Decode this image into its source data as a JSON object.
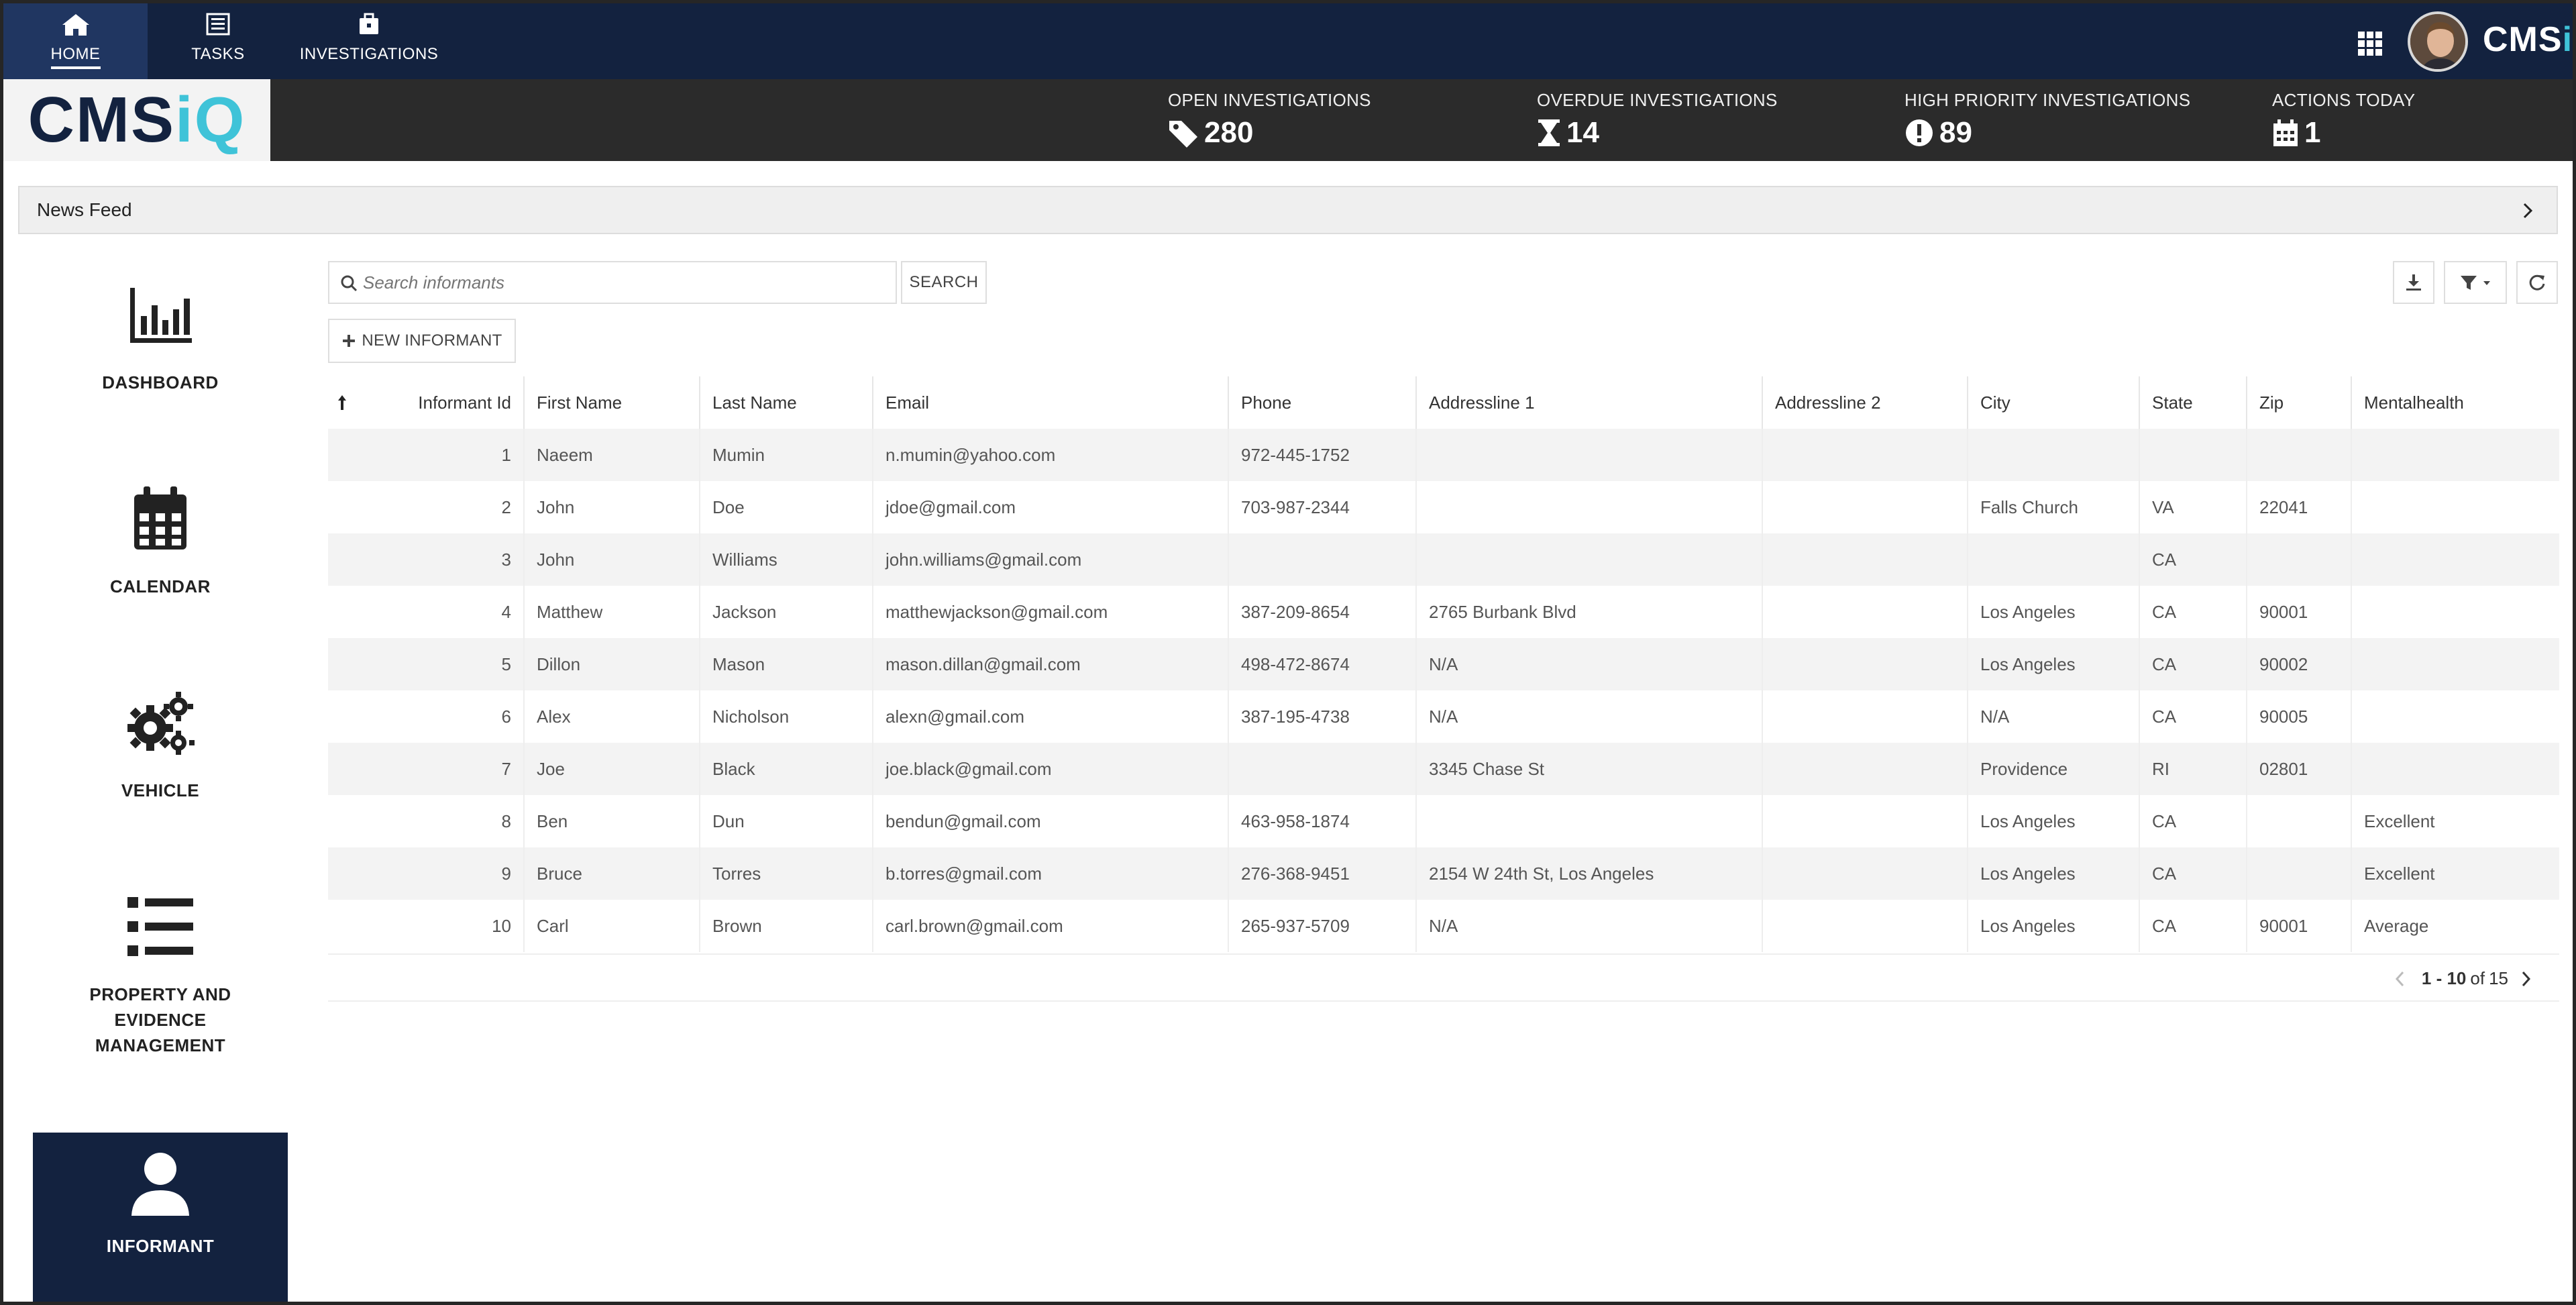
{
  "topnav": {
    "items": [
      {
        "label": "HOME",
        "icon": "home-icon"
      },
      {
        "label": "TASKS",
        "icon": "tasks-icon"
      },
      {
        "label": "INVESTIGATIONS",
        "icon": "briefcase-icon"
      }
    ],
    "brand": {
      "prefix": "CMS",
      "suffix": "iQ"
    }
  },
  "logo": {
    "prefix": "CMS",
    "suffix": "iQ"
  },
  "stats": [
    {
      "label": "OPEN INVESTIGATIONS",
      "value": "280",
      "icon": "tag-icon"
    },
    {
      "label": "OVERDUE INVESTIGATIONS",
      "value": "14",
      "icon": "hourglass-icon"
    },
    {
      "label": "HIGH PRIORITY INVESTIGATIONS",
      "value": "89",
      "icon": "exclamation-circle-icon"
    },
    {
      "label": "ACTIONS TODAY",
      "value": "1",
      "icon": "calendar-icon"
    }
  ],
  "newsfeed": {
    "label": "News Feed"
  },
  "sidebar": {
    "items": [
      {
        "label": "DASHBOARD",
        "icon": "bar-chart-icon"
      },
      {
        "label": "CALENDAR",
        "icon": "calendar-icon"
      },
      {
        "label": "VEHICLE",
        "icon": "gears-icon"
      },
      {
        "label": "PROPERTY AND EVIDENCE MANAGEMENT",
        "icon": "list-icon"
      },
      {
        "label": "INFORMANT",
        "icon": "user-icon",
        "active": true
      }
    ]
  },
  "search": {
    "placeholder": "Search informants",
    "button_label": "SEARCH"
  },
  "new_button": {
    "label": "NEW INFORMANT"
  },
  "table": {
    "columns": [
      "Informant Id",
      "First Name",
      "Last Name",
      "Email",
      "Phone",
      "Addressline 1",
      "Addressline 2",
      "City",
      "State",
      "Zip",
      "Mentalhealth"
    ],
    "rows": [
      [
        "1",
        "Naeem",
        "Mumin",
        "n.mumin@yahoo.com",
        "972-445-1752",
        "",
        "",
        "",
        "",
        "",
        ""
      ],
      [
        "2",
        "John",
        "Doe",
        "jdoe@gmail.com",
        "703-987-2344",
        "",
        "",
        "Falls Church",
        "VA",
        "22041",
        ""
      ],
      [
        "3",
        "John",
        "Williams",
        "john.williams@gmail.com",
        "",
        "",
        "",
        "",
        "CA",
        "",
        ""
      ],
      [
        "4",
        "Matthew",
        "Jackson",
        "matthewjackson@gmail.com",
        "387-209-8654",
        "2765 Burbank Blvd",
        "",
        "Los Angeles",
        "CA",
        "90001",
        ""
      ],
      [
        "5",
        "Dillon",
        "Mason",
        "mason.dillan@gmail.com",
        "498-472-8674",
        "N/A",
        "",
        "Los Angeles",
        "CA",
        "90002",
        ""
      ],
      [
        "6",
        "Alex",
        "Nicholson",
        "alexn@gmail.com",
        "387-195-4738",
        "N/A",
        "",
        "N/A",
        "CA",
        "90005",
        ""
      ],
      [
        "7",
        "Joe",
        "Black",
        "joe.black@gmail.com",
        "",
        "3345 Chase St",
        "",
        "Providence",
        "RI",
        "02801",
        ""
      ],
      [
        "8",
        "Ben",
        "Dun",
        "bendun@gmail.com",
        "463-958-1874",
        "",
        "",
        "Los Angeles",
        "CA",
        "",
        "Excellent"
      ],
      [
        "9",
        "Bruce",
        "Torres",
        "b.torres@gmail.com",
        "276-368-9451",
        "2154 W 24th St, Los Angeles",
        "",
        "Los Angeles",
        "CA",
        "",
        "Excellent"
      ],
      [
        "10",
        "Carl",
        "Brown",
        "carl.brown@gmail.com",
        "265-937-5709",
        "N/A",
        "",
        "Los Angeles",
        "CA",
        "90001",
        "Average"
      ]
    ]
  },
  "pager": {
    "range": "1 - 10",
    "of_label": "of",
    "total": "15"
  },
  "colors": {
    "nav_bg": "#13223f",
    "stats_bg": "#2b2b2b",
    "accent": "#3fc3d8"
  }
}
